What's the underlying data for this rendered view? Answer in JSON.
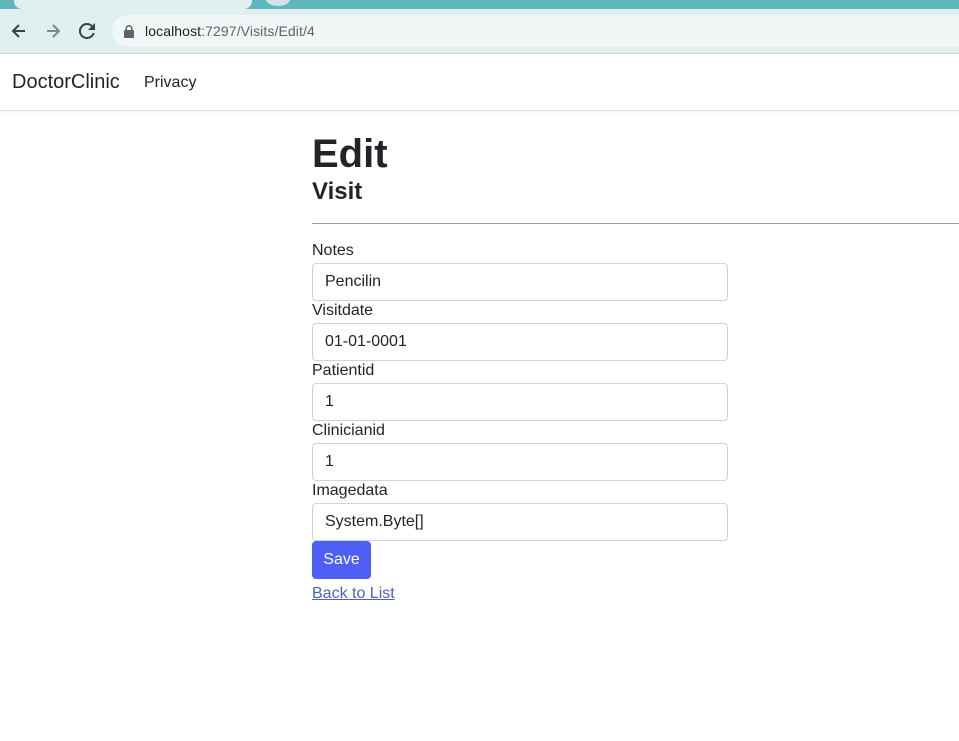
{
  "browser": {
    "url_host": "localhost",
    "url_path": ":7297/Visits/Edit/4"
  },
  "navbar": {
    "brand": "DoctorClinic",
    "links": [
      {
        "label": "Privacy"
      }
    ]
  },
  "page": {
    "title": "Edit",
    "subtitle": "Visit"
  },
  "form": {
    "fields": [
      {
        "label": "Notes",
        "value": "Pencilin"
      },
      {
        "label": "Visitdate",
        "value": "01-01-0001"
      },
      {
        "label": "Patientid",
        "value": "1"
      },
      {
        "label": "Clinicianid",
        "value": "1"
      },
      {
        "label": "Imagedata",
        "value": "System.Byte[]"
      }
    ],
    "save_label": "Save",
    "back_label": "Back to List"
  },
  "colors": {
    "primary_button": "#4f5ff3",
    "link": "#4f5fc4",
    "tab_strip": "#5fb7bd"
  }
}
